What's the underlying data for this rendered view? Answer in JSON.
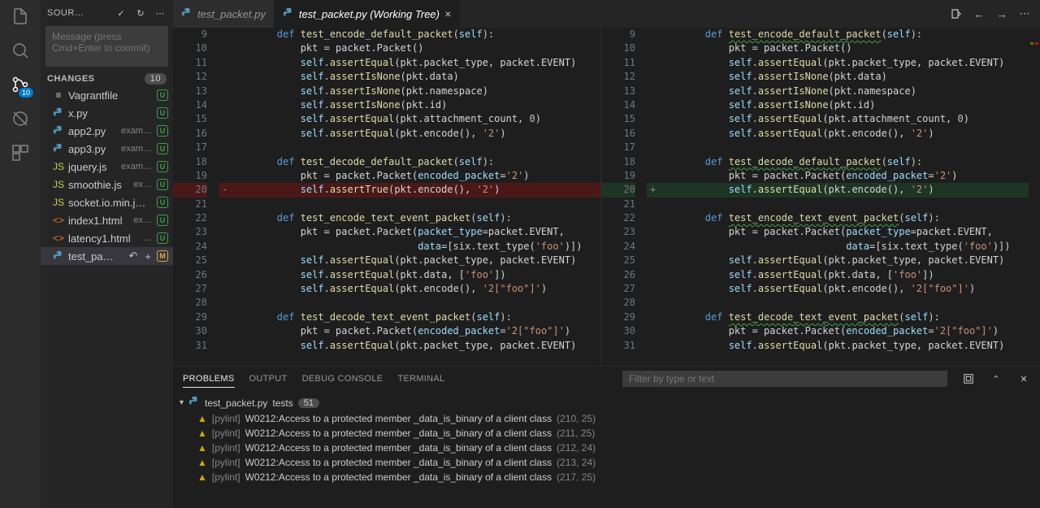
{
  "sidebarTitle": "SOUR…",
  "badge": "10",
  "commitPlaceholder": "Message (press Cmd+Enter to commit)",
  "changesTitle": "CHANGES",
  "changesCount": "10",
  "files": [
    {
      "icon": "≡",
      "iconColor": "#cccccc",
      "name": "Vagrantfile",
      "path": "",
      "status": "U"
    },
    {
      "icon": "py",
      "iconColor": "#519aba",
      "name": "x.py",
      "path": "",
      "status": "U"
    },
    {
      "icon": "py",
      "iconColor": "#519aba",
      "name": "app2.py",
      "path": "exam…",
      "status": "U"
    },
    {
      "icon": "py",
      "iconColor": "#519aba",
      "name": "app3.py",
      "path": "exam…",
      "status": "U"
    },
    {
      "icon": "JS",
      "iconColor": "#cbcb41",
      "name": "jquery.js",
      "path": "exam…",
      "status": "U"
    },
    {
      "icon": "JS",
      "iconColor": "#cbcb41",
      "name": "smoothie.js",
      "path": "ex…",
      "status": "U"
    },
    {
      "icon": "JS",
      "iconColor": "#cbcb41",
      "name": "socket.io.min.j…",
      "path": "",
      "status": "U"
    },
    {
      "icon": "<>",
      "iconColor": "#e37933",
      "name": "index1.html",
      "path": "ex…",
      "status": "U"
    },
    {
      "icon": "<>",
      "iconColor": "#e37933",
      "name": "latency1.html",
      "path": "…",
      "status": "U"
    },
    {
      "icon": "py",
      "iconColor": "#519aba",
      "name": "test_pa…",
      "path": "",
      "status": "M",
      "selected": true,
      "actions": true
    }
  ],
  "tabs": [
    {
      "label": "test_packet.py",
      "active": false
    },
    {
      "label": "test_packet.py (Working Tree)",
      "active": true,
      "close": true
    }
  ],
  "code": {
    "lines": [
      9,
      10,
      11,
      12,
      13,
      14,
      15,
      16,
      17,
      18,
      19,
      20,
      21,
      22,
      23,
      24,
      25,
      26,
      27,
      28,
      29,
      30,
      31
    ],
    "left": [
      {
        "t": "def",
        "fn": "test_encode_default_packet",
        "arg": "self",
        "ind": 2
      },
      {
        "raw": "pkt = packet.Packet()",
        "ind": 3
      },
      {
        "slf": true,
        "m": "assertEqual",
        "args": "(pkt.packet_type, packet.EVENT)",
        "ind": 3
      },
      {
        "slf": true,
        "m": "assertIsNone",
        "args": "(pkt.data)",
        "ind": 3
      },
      {
        "slf": true,
        "m": "assertIsNone",
        "args": "(pkt.namespace)",
        "ind": 3
      },
      {
        "slf": true,
        "m": "assertIsNone",
        "args": "(pkt.id)",
        "ind": 3
      },
      {
        "slf": true,
        "m": "assertEqual",
        "args": "(pkt.attachment_count, ",
        "num": "0",
        "tail": ")",
        "ind": 3
      },
      {
        "slf": true,
        "m": "assertEqual",
        "args": "(pkt.encode(), ",
        "str": "'2'",
        "tail": ")",
        "ind": 3
      },
      {
        "blank": true
      },
      {
        "t": "def",
        "fn": "test_decode_default_packet",
        "arg": "self",
        "ind": 2
      },
      {
        "raw": "pkt = packet.Packet(",
        "kw2": "encoded_packet",
        "eq": "=",
        "str": "'2'",
        "tail": ")",
        "ind": 3
      },
      {
        "slf": true,
        "m": "assertTrue",
        "args": "(pkt.encode(), ",
        "str": "'2'",
        "tail": ")",
        "ind": 3,
        "removed": true,
        "sign": "-"
      },
      {
        "blank": true
      },
      {
        "t": "def",
        "fn": "test_encode_text_event_packet",
        "arg": "self",
        "ind": 2
      },
      {
        "raw": "pkt = packet.Packet(",
        "kw2": "packet_type",
        "eq": "=packet.EVENT,",
        "ind": 3
      },
      {
        "cont": true,
        "kw2": "data",
        "eq": "=[six.text_type(",
        "str": "'foo'",
        "tail": ")])",
        "ind": 3
      },
      {
        "slf": true,
        "m": "assertEqual",
        "args": "(pkt.packet_type, packet.EVENT)",
        "ind": 3
      },
      {
        "slf": true,
        "m": "assertEqual",
        "args": "(pkt.data, [",
        "str": "'foo'",
        "tail": "])",
        "ind": 3
      },
      {
        "slf": true,
        "m": "assertEqual",
        "args": "(pkt.encode(), ",
        "str": "'2[\"foo\"]'",
        "tail": ")",
        "ind": 3
      },
      {
        "blank": true
      },
      {
        "t": "def",
        "fn": "test_decode_text_event_packet",
        "arg": "self",
        "ind": 2
      },
      {
        "raw": "pkt = packet.Packet(",
        "kw2": "encoded_packet",
        "eq": "=",
        "str": "'2[\"foo\"]'",
        "tail": ")",
        "ind": 3
      },
      {
        "slf": true,
        "m": "assertEqual",
        "args": "(pkt.packet_type, packet.EVENT)",
        "ind": 3
      }
    ],
    "right": [
      {
        "t": "def",
        "fn": "test_encode_default_packet",
        "arg": "self",
        "ind": 2,
        "u": true
      },
      {
        "raw": "pkt = packet.Packet()",
        "ind": 3
      },
      {
        "slf": true,
        "m": "assertEqual",
        "args": "(pkt.packet_type, packet.EVENT)",
        "ind": 3
      },
      {
        "slf": true,
        "m": "assertIsNone",
        "args": "(pkt.data)",
        "ind": 3
      },
      {
        "slf": true,
        "m": "assertIsNone",
        "args": "(pkt.namespace)",
        "ind": 3
      },
      {
        "slf": true,
        "m": "assertIsNone",
        "args": "(pkt.id)",
        "ind": 3
      },
      {
        "slf": true,
        "m": "assertEqual",
        "args": "(pkt.attachment_count, ",
        "num": "0",
        "tail": ")",
        "ind": 3
      },
      {
        "slf": true,
        "m": "assertEqual",
        "args": "(pkt.encode(), ",
        "str": "'2'",
        "tail": ")",
        "ind": 3
      },
      {
        "blank": true
      },
      {
        "t": "def",
        "fn": "test_decode_default_packet",
        "arg": "self",
        "ind": 2,
        "u": true
      },
      {
        "raw": "pkt = packet.Packet(",
        "kw2": "encoded_packet",
        "eq": "=",
        "str": "'2'",
        "tail": ")",
        "ind": 3
      },
      {
        "slf": true,
        "m": "assertEqual",
        "args": "(pkt.encode(), ",
        "str": "'2'",
        "tail": ")",
        "ind": 3,
        "added": true,
        "sign": "+"
      },
      {
        "blank": true
      },
      {
        "t": "def",
        "fn": "test_encode_text_event_packet",
        "arg": "self",
        "ind": 2,
        "u": true
      },
      {
        "raw": "pkt = packet.Packet(",
        "kw2": "packet_type",
        "eq": "=packet.EVENT,",
        "ind": 3
      },
      {
        "cont": true,
        "kw2": "data",
        "eq": "=[six.text_type(",
        "str": "'foo'",
        "tail": ")])",
        "ind": 3
      },
      {
        "slf": true,
        "m": "assertEqual",
        "args": "(pkt.packet_type, packet.EVENT)",
        "ind": 3
      },
      {
        "slf": true,
        "m": "assertEqual",
        "args": "(pkt.data, [",
        "str": "'foo'",
        "tail": "])",
        "ind": 3
      },
      {
        "slf": true,
        "m": "assertEqual",
        "args": "(pkt.encode(), ",
        "str": "'2[\"foo\"]'",
        "tail": ")",
        "ind": 3
      },
      {
        "blank": true
      },
      {
        "t": "def",
        "fn": "test_decode_text_event_packet",
        "arg": "self",
        "ind": 2,
        "u": true
      },
      {
        "raw": "pkt = packet.Packet(",
        "kw2": "encoded_packet",
        "eq": "=",
        "str": "'2[\"foo\"]'",
        "tail": ")",
        "ind": 3
      },
      {
        "slf": true,
        "m": "assertEqual",
        "args": "(pkt.packet_type, packet.EVENT)",
        "ind": 3
      }
    ]
  },
  "panel": {
    "tabs": [
      "PROBLEMS",
      "OUTPUT",
      "DEBUG CONSOLE",
      "TERMINAL"
    ],
    "filterPlaceholder": "Filter by type or text",
    "file": "test_packet.py",
    "filePath": "tests",
    "fileCount": "51",
    "items": [
      {
        "src": "[pylint]",
        "msg": "W0212:Access to a protected member _data_is_binary of a client class",
        "loc": "(210, 25)"
      },
      {
        "src": "[pylint]",
        "msg": "W0212:Access to a protected member _data_is_binary of a client class",
        "loc": "(211, 25)"
      },
      {
        "src": "[pylint]",
        "msg": "W0212:Access to a protected member _data_is_binary of a client class",
        "loc": "(212, 24)"
      },
      {
        "src": "[pylint]",
        "msg": "W0212:Access to a protected member _data_is_binary of a client class",
        "loc": "(213, 24)"
      },
      {
        "src": "[pylint]",
        "msg": "W0212:Access to a protected member _data_is_binary of a client class",
        "loc": "(217, 25)"
      }
    ]
  }
}
